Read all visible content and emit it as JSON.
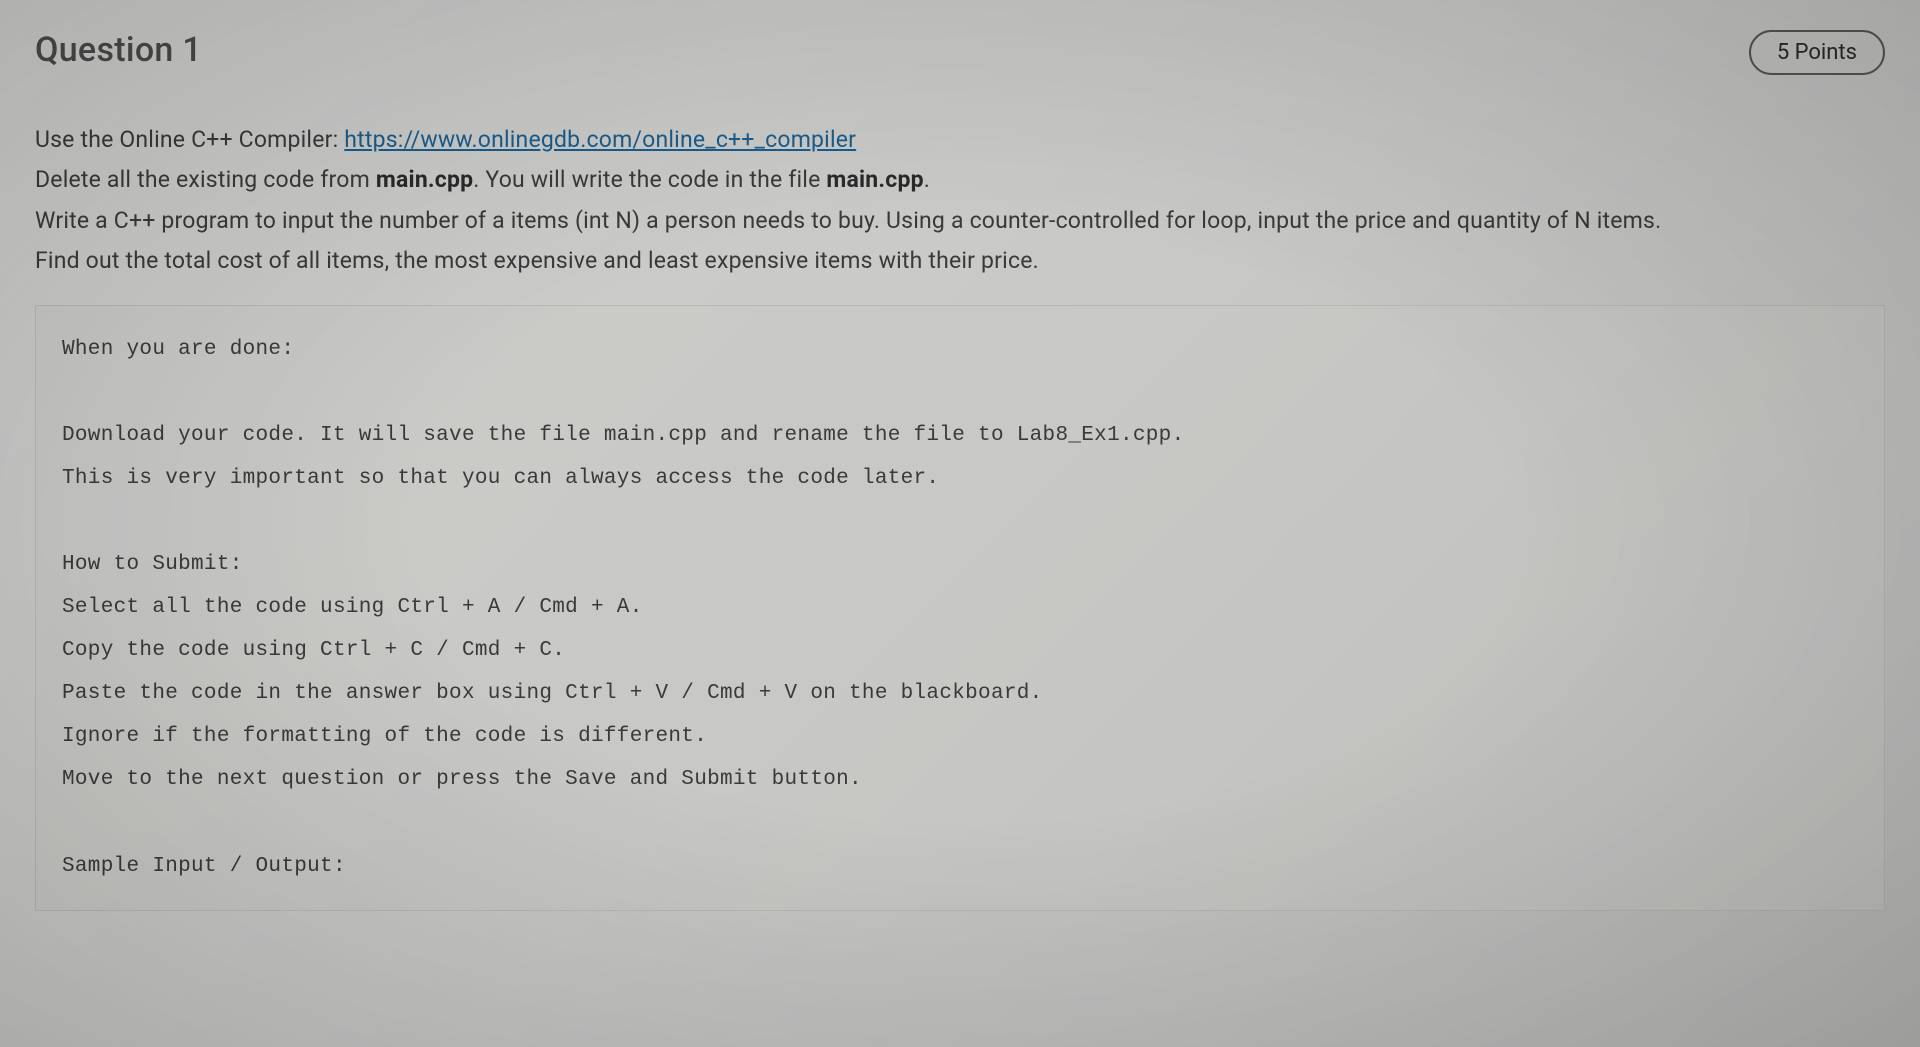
{
  "header": {
    "title": "Question 1",
    "points": "5 Points"
  },
  "body": {
    "line1_prefix": "Use the Online C++ Compiler: ",
    "line1_link": "https://www.onlinegdb.com/online_c++_compiler",
    "line2_prefix": "Delete all the existing code from ",
    "line2_bold1": "main.cpp",
    "line2_mid": ". You will write the code in the file ",
    "line2_bold2": "main.cpp",
    "line2_suffix": ".",
    "line3": "Write a C++ program to input the number of a items (int N) a person needs to buy. Using a counter-controlled for loop, input the price and quantity of N items.",
    "line4": "Find out the total cost of all items, the most expensive and least expensive items with their price."
  },
  "code": {
    "text": "When you are done:\n\nDownload your code. It will save the file main.cpp and rename the file to Lab8_Ex1.cpp.\nThis is very important so that you can always access the code later.\n\nHow to Submit:\nSelect all the code using Ctrl + A / Cmd + A.\nCopy the code using Ctrl + C / Cmd + C.\nPaste the code in the answer box using Ctrl + V / Cmd + V on the blackboard.\nIgnore if the formatting of the code is different.\nMove to the next question or press the Save and Submit button.\n\nSample Input / Output:"
  }
}
